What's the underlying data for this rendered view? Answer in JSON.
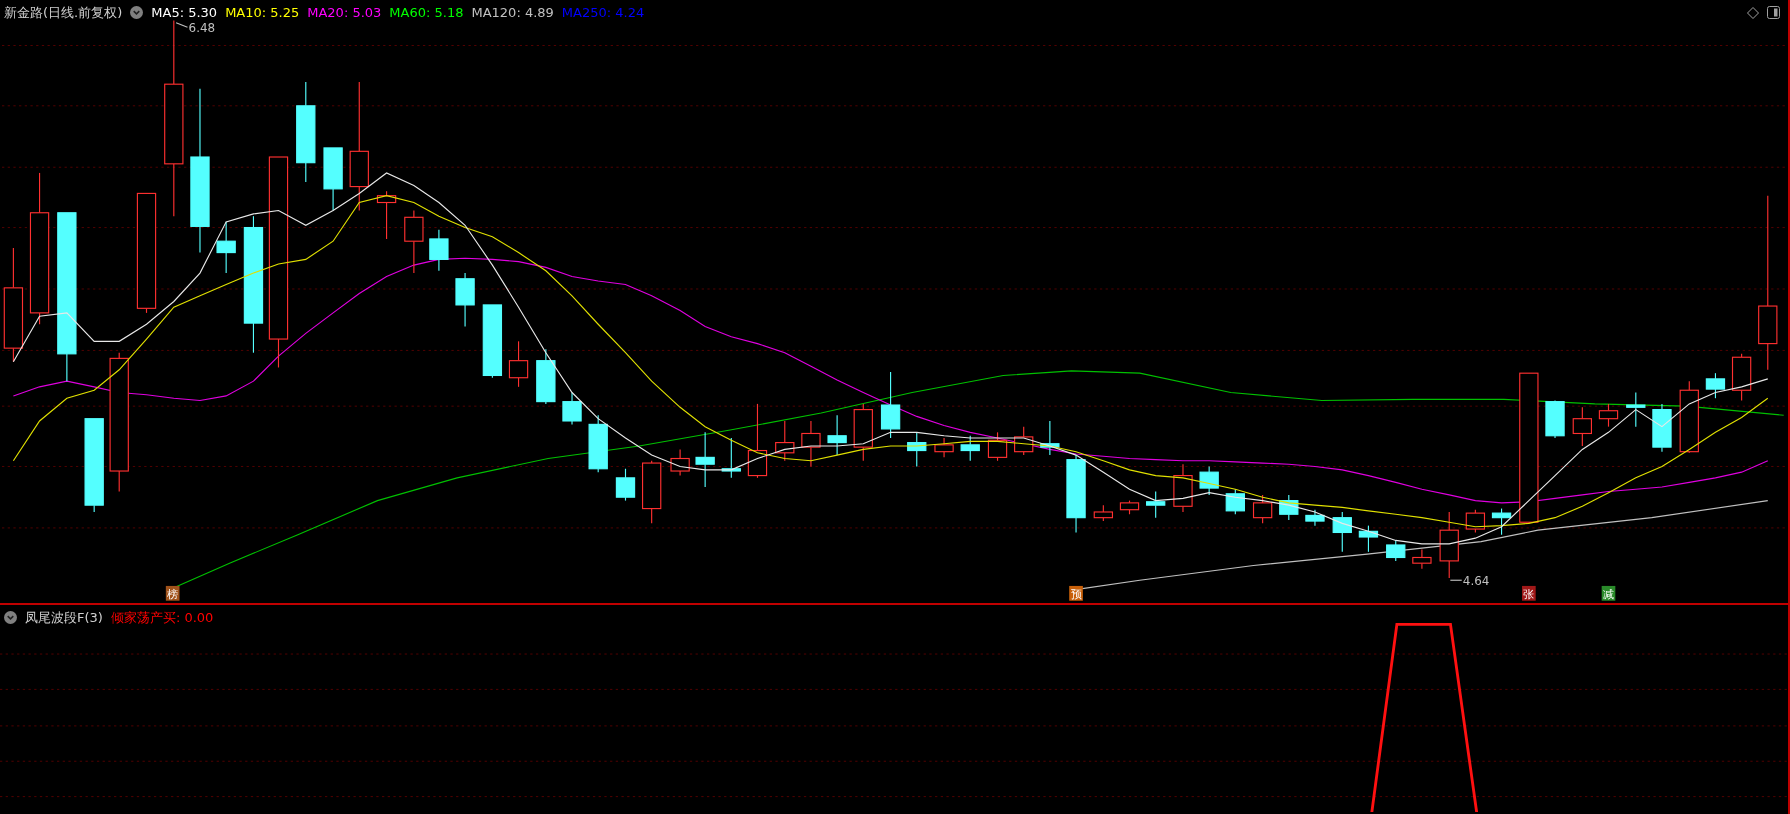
{
  "main_chart": {
    "title": "新金路(日线.前复权)",
    "legend": [
      {
        "text": "MA5: 5.30",
        "color": "#ffffff"
      },
      {
        "text": "MA10: 5.25",
        "color": "#ffff00"
      },
      {
        "text": "MA20: 5.03",
        "color": "#ff00ff"
      },
      {
        "text": "MA60: 5.18",
        "color": "#00ff00"
      },
      {
        "text": "MA120: 4.89",
        "color": "#c0c0c0"
      },
      {
        "text": "MA250: 4.24",
        "color": "#0000ff"
      }
    ],
    "high_label": "6.48",
    "low_label": "4.64",
    "signals": [
      {
        "text": "榜",
        "color": "#a0521a"
      },
      {
        "text": "预",
        "color": "#c8600a"
      },
      {
        "text": "张",
        "color": "#a01818"
      },
      {
        "text": "减",
        "color": "#2a8a2a"
      }
    ]
  },
  "indicator": {
    "title": "凤尾波段F(3)",
    "legend": [
      {
        "text": "倾家荡产买: 0.00",
        "color": "#ff0000"
      }
    ]
  }
}
